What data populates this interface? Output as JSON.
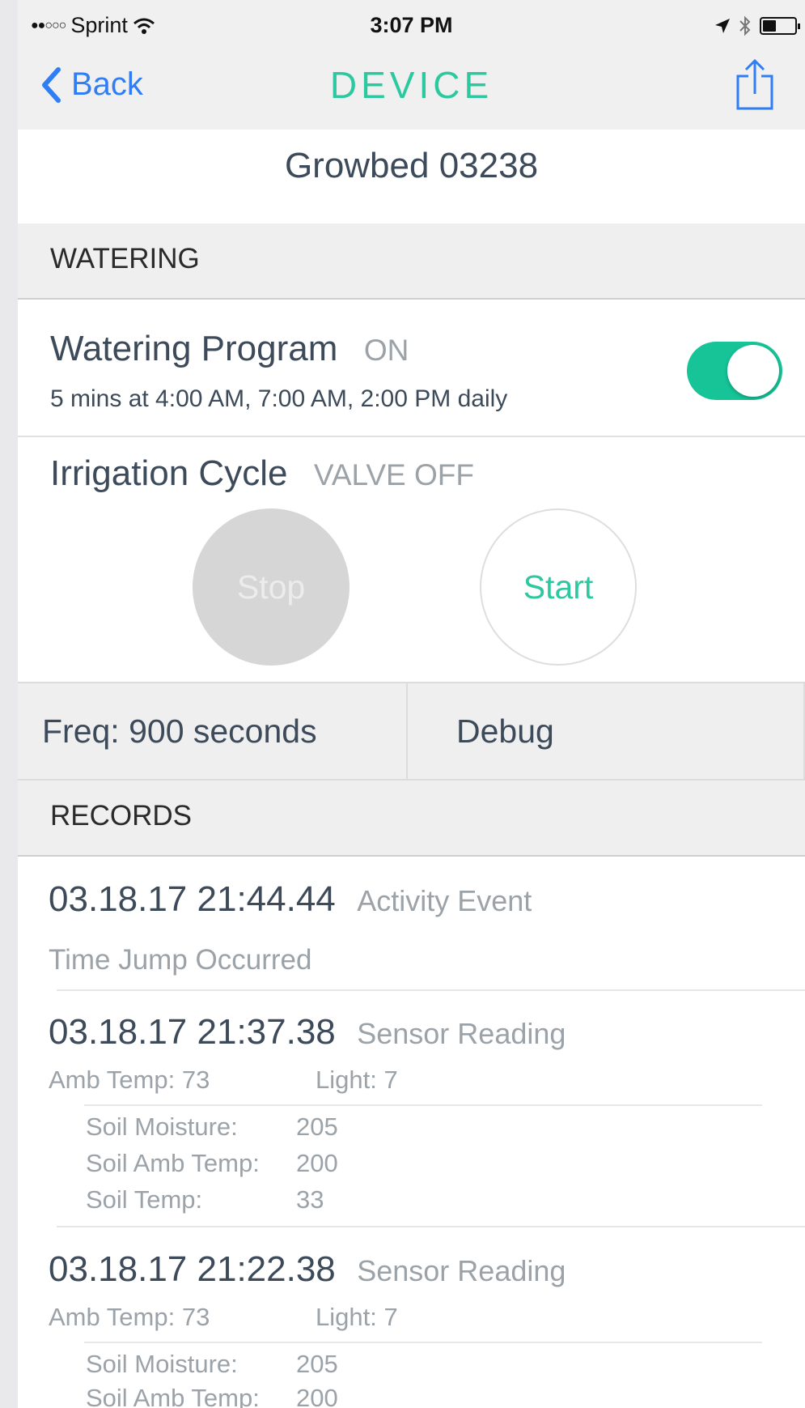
{
  "status_bar": {
    "signal": "●●○○○",
    "carrier": "Sprint",
    "time": "3:07 PM"
  },
  "nav": {
    "back_label": "Back",
    "title": "DEVICE"
  },
  "device": {
    "name": "Growbed 03238"
  },
  "watering_section": {
    "header": "WATERING"
  },
  "watering_program": {
    "title": "Watering Program",
    "status": "ON",
    "schedule": "5 mins at 4:00 AM, 7:00 AM, 2:00 PM daily",
    "enabled": true,
    "toggle_color": "#16c497"
  },
  "irrigation": {
    "title": "Irrigation Cycle",
    "status": "VALVE OFF",
    "stop_label": "Stop",
    "start_label": "Start"
  },
  "controls": {
    "freq_label": "Freq: 900 seconds",
    "debug_label": "Debug"
  },
  "records_section": {
    "header": "RECORDS"
  },
  "records": [
    {
      "timestamp": "03.18.17 21:44.44",
      "type": "Activity Event",
      "message": "Time Jump Occurred"
    },
    {
      "timestamp": "03.18.17 21:37.38",
      "type": "Sensor Reading",
      "amb_temp": "Amb Temp: 73",
      "light": "Light: 7",
      "soil": [
        {
          "label": "Soil Moisture:",
          "value": "205"
        },
        {
          "label": "Soil Amb Temp:",
          "value": "200"
        },
        {
          "label": "Soil Temp:",
          "value": "33"
        }
      ]
    },
    {
      "timestamp": "03.18.17 21:22.38",
      "type": "Sensor Reading",
      "amb_temp": "Amb Temp: 73",
      "light": "Light: 7",
      "soil": [
        {
          "label": "Soil Moisture:",
          "value": "205"
        },
        {
          "label": "Soil Amb Temp:",
          "value": "200"
        }
      ]
    }
  ],
  "colors": {
    "accent_teal": "#2cc9a0",
    "link_blue": "#2f7ef6"
  }
}
